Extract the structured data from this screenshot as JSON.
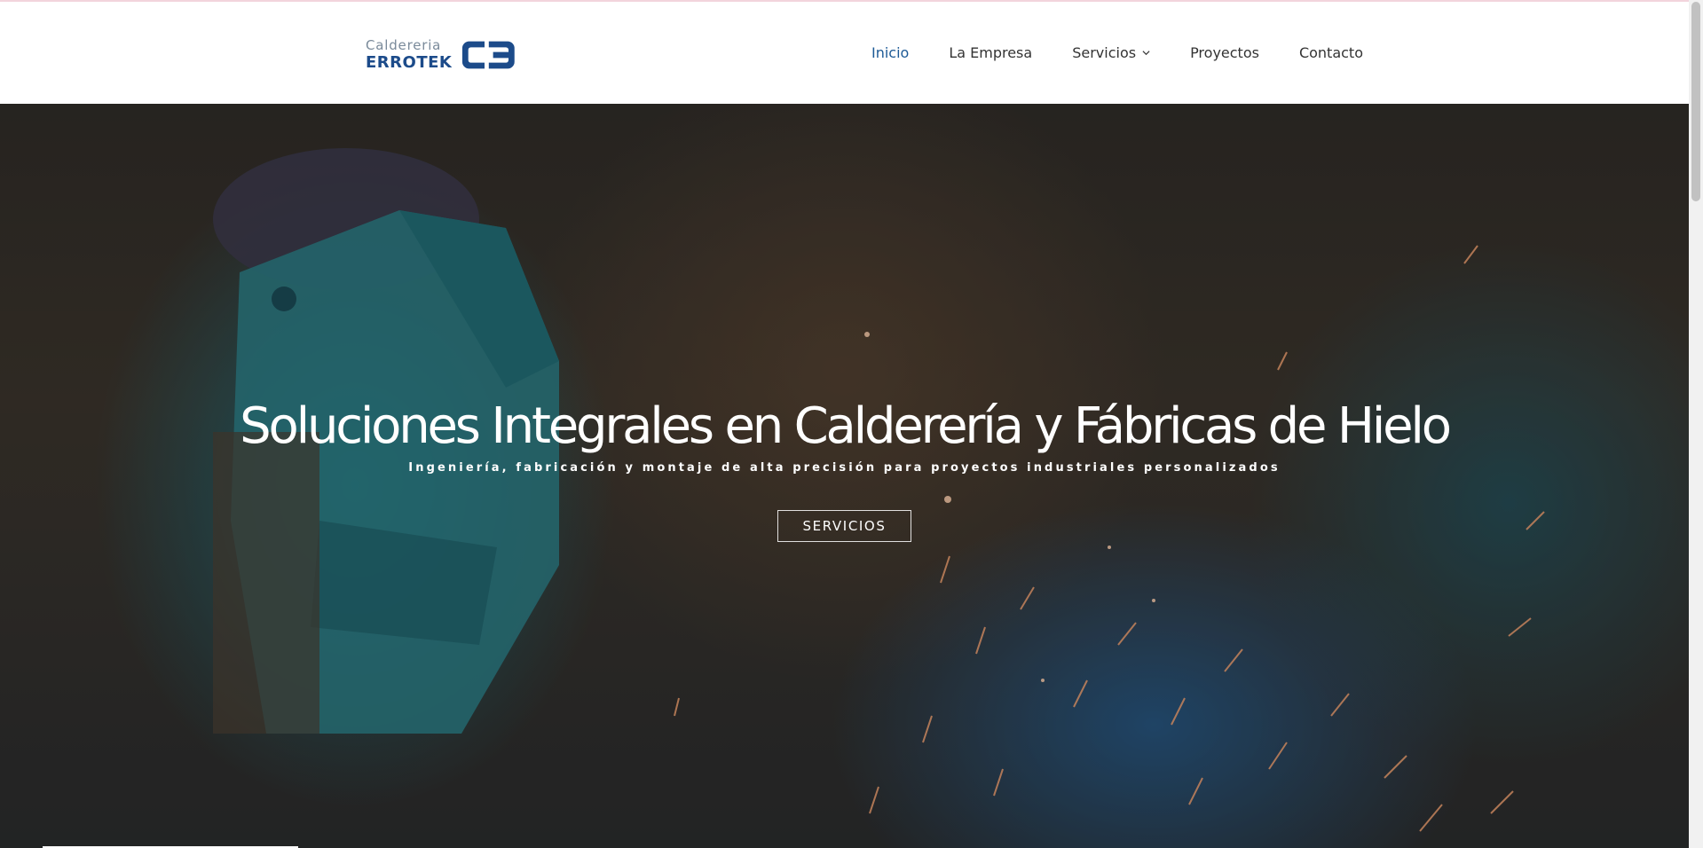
{
  "header": {
    "logo": {
      "small": "Caldereria",
      "big": "ERROTEK",
      "mark_color": "#1c4b8a"
    },
    "nav": [
      {
        "label": "Inicio",
        "active": true
      },
      {
        "label": "La Empresa"
      },
      {
        "label": "Servicios",
        "has_dropdown": true
      },
      {
        "label": "Proyectos"
      },
      {
        "label": "Contacto"
      }
    ]
  },
  "hero": {
    "title": "Soluciones Integrales en Calderería y Fábricas de Hielo",
    "subtitle": "Ingeniería, fabricación y montaje de alta precisión para proyectos industriales personalizados",
    "button_label": "SERVICIOS"
  },
  "colors": {
    "accent": "#1d5a96",
    "nav_text": "#333333",
    "hero_text": "#ffffff"
  }
}
